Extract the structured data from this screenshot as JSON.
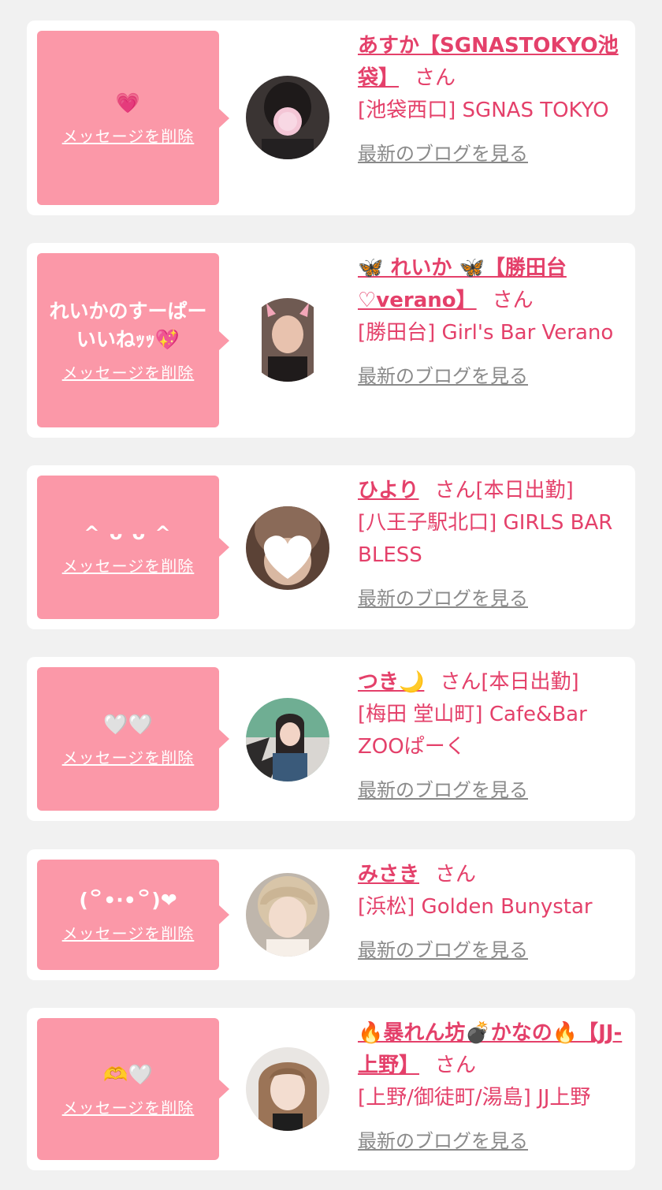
{
  "common": {
    "delete_label": "メッセージを削除",
    "blog_label": "最新のブログを見る",
    "san": "さん"
  },
  "items": [
    {
      "message": "💗",
      "name": "あすか【SGNASTOKYO池袋】",
      "status": "",
      "shop": "[池袋西口] SGNAS TOKYO"
    },
    {
      "message": "れいかのすーぱーいいねｯｯ💖",
      "name": "🦋 れいか 🦋【勝田台♡verano】",
      "status": "",
      "shop": "[勝田台] Girl's Bar Verano"
    },
    {
      "message": "^ ᴗ ᴗ ^",
      "name": "ひより",
      "status": "[本日出勤]",
      "shop": "[八王子駅北口] GIRLS BAR BLESS"
    },
    {
      "message": "🤍🤍",
      "name": "つき🌙",
      "status": "[本日出勤]",
      "shop": "[梅田 堂山町] Cafe&Bar ZOOぱーく"
    },
    {
      "message": "(꒪•·•꒪)❤",
      "name": "みさき",
      "status": "",
      "shop": "[浜松] Golden Bunystar"
    },
    {
      "message": "🫶🤍",
      "name": "🔥暴れん坊💣かなの🔥【JJ-上野】",
      "status": "",
      "shop": "[上野/御徒町/湯島] JJ上野"
    }
  ]
}
